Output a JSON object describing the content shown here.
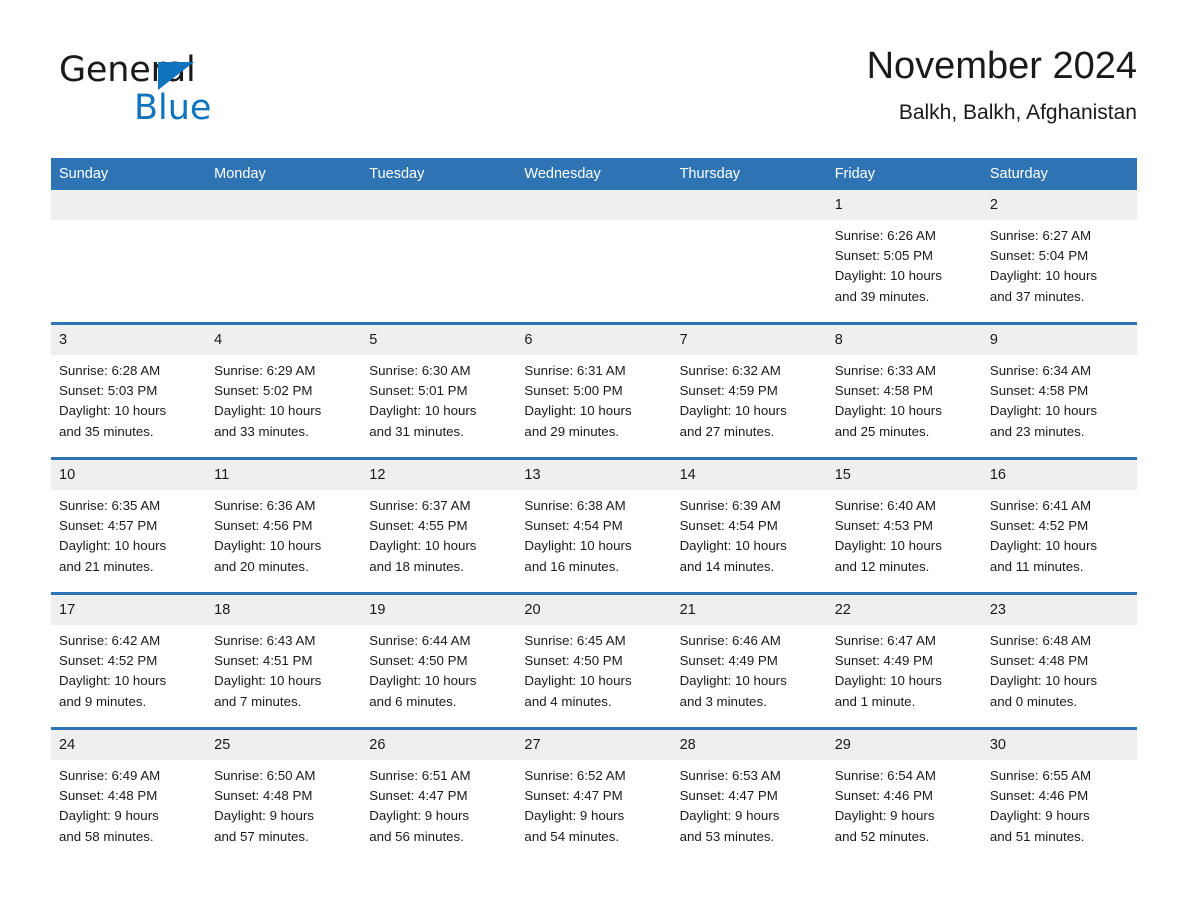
{
  "logo": {
    "word_one": "General",
    "word_two": "Blue",
    "triangle_color": "#1074bc",
    "icon": "triangle-flag-icon"
  },
  "header": {
    "title": "November 2024",
    "subtitle": "Balkh, Balkh, Afghanistan"
  },
  "colors": {
    "header_blue": "#2e74b5",
    "daynum_grey": "#efefef",
    "text": "#1a1a1a",
    "logo_blue": "#1074bc"
  },
  "calendar": {
    "weekday_headers": [
      "Sunday",
      "Monday",
      "Tuesday",
      "Wednesday",
      "Thursday",
      "Friday",
      "Saturday"
    ],
    "weeks": [
      [
        {
          "day": "",
          "lines": []
        },
        {
          "day": "",
          "lines": []
        },
        {
          "day": "",
          "lines": []
        },
        {
          "day": "",
          "lines": []
        },
        {
          "day": "",
          "lines": []
        },
        {
          "day": "1",
          "lines": [
            "Sunrise: 6:26 AM",
            "Sunset: 5:05 PM",
            "Daylight: 10 hours",
            "and 39 minutes."
          ]
        },
        {
          "day": "2",
          "lines": [
            "Sunrise: 6:27 AM",
            "Sunset: 5:04 PM",
            "Daylight: 10 hours",
            "and 37 minutes."
          ]
        }
      ],
      [
        {
          "day": "3",
          "lines": [
            "Sunrise: 6:28 AM",
            "Sunset: 5:03 PM",
            "Daylight: 10 hours",
            "and 35 minutes."
          ]
        },
        {
          "day": "4",
          "lines": [
            "Sunrise: 6:29 AM",
            "Sunset: 5:02 PM",
            "Daylight: 10 hours",
            "and 33 minutes."
          ]
        },
        {
          "day": "5",
          "lines": [
            "Sunrise: 6:30 AM",
            "Sunset: 5:01 PM",
            "Daylight: 10 hours",
            "and 31 minutes."
          ]
        },
        {
          "day": "6",
          "lines": [
            "Sunrise: 6:31 AM",
            "Sunset: 5:00 PM",
            "Daylight: 10 hours",
            "and 29 minutes."
          ]
        },
        {
          "day": "7",
          "lines": [
            "Sunrise: 6:32 AM",
            "Sunset: 4:59 PM",
            "Daylight: 10 hours",
            "and 27 minutes."
          ]
        },
        {
          "day": "8",
          "lines": [
            "Sunrise: 6:33 AM",
            "Sunset: 4:58 PM",
            "Daylight: 10 hours",
            "and 25 minutes."
          ]
        },
        {
          "day": "9",
          "lines": [
            "Sunrise: 6:34 AM",
            "Sunset: 4:58 PM",
            "Daylight: 10 hours",
            "and 23 minutes."
          ]
        }
      ],
      [
        {
          "day": "10",
          "lines": [
            "Sunrise: 6:35 AM",
            "Sunset: 4:57 PM",
            "Daylight: 10 hours",
            "and 21 minutes."
          ]
        },
        {
          "day": "11",
          "lines": [
            "Sunrise: 6:36 AM",
            "Sunset: 4:56 PM",
            "Daylight: 10 hours",
            "and 20 minutes."
          ]
        },
        {
          "day": "12",
          "lines": [
            "Sunrise: 6:37 AM",
            "Sunset: 4:55 PM",
            "Daylight: 10 hours",
            "and 18 minutes."
          ]
        },
        {
          "day": "13",
          "lines": [
            "Sunrise: 6:38 AM",
            "Sunset: 4:54 PM",
            "Daylight: 10 hours",
            "and 16 minutes."
          ]
        },
        {
          "day": "14",
          "lines": [
            "Sunrise: 6:39 AM",
            "Sunset: 4:54 PM",
            "Daylight: 10 hours",
            "and 14 minutes."
          ]
        },
        {
          "day": "15",
          "lines": [
            "Sunrise: 6:40 AM",
            "Sunset: 4:53 PM",
            "Daylight: 10 hours",
            "and 12 minutes."
          ]
        },
        {
          "day": "16",
          "lines": [
            "Sunrise: 6:41 AM",
            "Sunset: 4:52 PM",
            "Daylight: 10 hours",
            "and 11 minutes."
          ]
        }
      ],
      [
        {
          "day": "17",
          "lines": [
            "Sunrise: 6:42 AM",
            "Sunset: 4:52 PM",
            "Daylight: 10 hours",
            "and 9 minutes."
          ]
        },
        {
          "day": "18",
          "lines": [
            "Sunrise: 6:43 AM",
            "Sunset: 4:51 PM",
            "Daylight: 10 hours",
            "and 7 minutes."
          ]
        },
        {
          "day": "19",
          "lines": [
            "Sunrise: 6:44 AM",
            "Sunset: 4:50 PM",
            "Daylight: 10 hours",
            "and 6 minutes."
          ]
        },
        {
          "day": "20",
          "lines": [
            "Sunrise: 6:45 AM",
            "Sunset: 4:50 PM",
            "Daylight: 10 hours",
            "and 4 minutes."
          ]
        },
        {
          "day": "21",
          "lines": [
            "Sunrise: 6:46 AM",
            "Sunset: 4:49 PM",
            "Daylight: 10 hours",
            "and 3 minutes."
          ]
        },
        {
          "day": "22",
          "lines": [
            "Sunrise: 6:47 AM",
            "Sunset: 4:49 PM",
            "Daylight: 10 hours",
            "and 1 minute."
          ]
        },
        {
          "day": "23",
          "lines": [
            "Sunrise: 6:48 AM",
            "Sunset: 4:48 PM",
            "Daylight: 10 hours",
            "and 0 minutes."
          ]
        }
      ],
      [
        {
          "day": "24",
          "lines": [
            "Sunrise: 6:49 AM",
            "Sunset: 4:48 PM",
            "Daylight: 9 hours",
            "and 58 minutes."
          ]
        },
        {
          "day": "25",
          "lines": [
            "Sunrise: 6:50 AM",
            "Sunset: 4:48 PM",
            "Daylight: 9 hours",
            "and 57 minutes."
          ]
        },
        {
          "day": "26",
          "lines": [
            "Sunrise: 6:51 AM",
            "Sunset: 4:47 PM",
            "Daylight: 9 hours",
            "and 56 minutes."
          ]
        },
        {
          "day": "27",
          "lines": [
            "Sunrise: 6:52 AM",
            "Sunset: 4:47 PM",
            "Daylight: 9 hours",
            "and 54 minutes."
          ]
        },
        {
          "day": "28",
          "lines": [
            "Sunrise: 6:53 AM",
            "Sunset: 4:47 PM",
            "Daylight: 9 hours",
            "and 53 minutes."
          ]
        },
        {
          "day": "29",
          "lines": [
            "Sunrise: 6:54 AM",
            "Sunset: 4:46 PM",
            "Daylight: 9 hours",
            "and 52 minutes."
          ]
        },
        {
          "day": "30",
          "lines": [
            "Sunrise: 6:55 AM",
            "Sunset: 4:46 PM",
            "Daylight: 9 hours",
            "and 51 minutes."
          ]
        }
      ]
    ]
  }
}
